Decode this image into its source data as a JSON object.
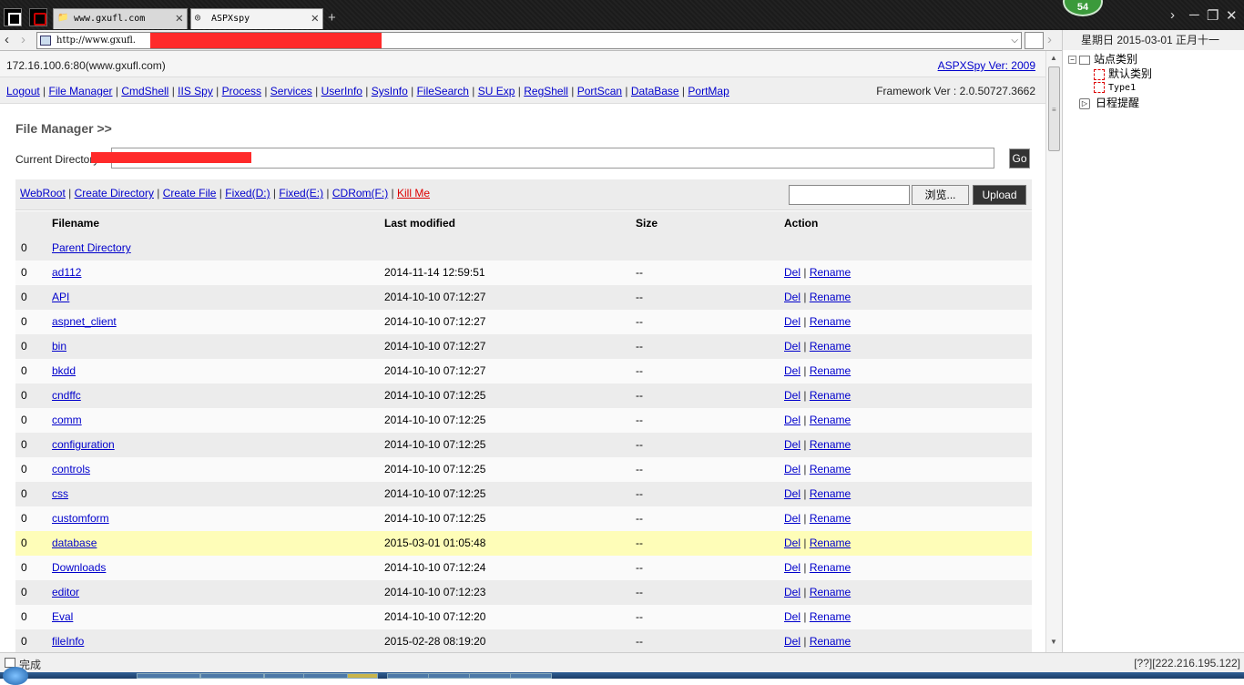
{
  "browser": {
    "tabs": [
      {
        "title": "www.gxufl.com",
        "active": false
      },
      {
        "title": "ASPXspy",
        "active": true
      }
    ],
    "url": "http://www.gxufl.",
    "notification_count": "54"
  },
  "sidepanel": {
    "date": "星期日 2015-03-01 正月十一",
    "tree": {
      "root": "站点类别",
      "children": [
        "默认类别",
        "Type1"
      ],
      "reminder": "日程提醒"
    }
  },
  "page": {
    "host": "172.16.100.6:80(www.gxufl.com)",
    "version_link": "ASPXSpy Ver: 2009",
    "framework": "Framework Ver : 2.0.50727.3662",
    "nav": [
      "Logout",
      "File Manager",
      "CmdShell",
      "IIS Spy",
      "Process",
      "Services",
      "UserInfo",
      "SysInfo",
      "FileSearch",
      "SU Exp",
      "RegShell",
      "PortScan",
      "DataBase",
      "PortMap"
    ],
    "title": "File Manager >>",
    "current_directory_label": "Current Directory",
    "current_directory_value": "",
    "go_label": "Go",
    "tools": [
      "WebRoot",
      "Create Directory",
      "Create File",
      "Fixed(D:)",
      "Fixed(E:)",
      "CDRom(F:)",
      "Kill Me"
    ],
    "browse_label": "浏览...",
    "upload_label": "Upload",
    "columns": [
      "Filename",
      "Last modified",
      "Size",
      "Action"
    ],
    "parent": {
      "num": "0",
      "name": "Parent Directory"
    },
    "rows": [
      {
        "num": "0",
        "name": "ad112",
        "modified": "2014-11-14 12:59:51",
        "size": "--"
      },
      {
        "num": "0",
        "name": "API",
        "modified": "2014-10-10 07:12:27",
        "size": "--"
      },
      {
        "num": "0",
        "name": "aspnet_client",
        "modified": "2014-10-10 07:12:27",
        "size": "--"
      },
      {
        "num": "0",
        "name": "bin",
        "modified": "2014-10-10 07:12:27",
        "size": "--"
      },
      {
        "num": "0",
        "name": "bkdd",
        "modified": "2014-10-10 07:12:27",
        "size": "--"
      },
      {
        "num": "0",
        "name": "cndffc",
        "modified": "2014-10-10 07:12:25",
        "size": "--"
      },
      {
        "num": "0",
        "name": "comm",
        "modified": "2014-10-10 07:12:25",
        "size": "--"
      },
      {
        "num": "0",
        "name": "configuration",
        "modified": "2014-10-10 07:12:25",
        "size": "--"
      },
      {
        "num": "0",
        "name": "controls",
        "modified": "2014-10-10 07:12:25",
        "size": "--"
      },
      {
        "num": "0",
        "name": "css",
        "modified": "2014-10-10 07:12:25",
        "size": "--"
      },
      {
        "num": "0",
        "name": "customform",
        "modified": "2014-10-10 07:12:25",
        "size": "--"
      },
      {
        "num": "0",
        "name": "database",
        "modified": "2015-03-01 01:05:48",
        "size": "--",
        "highlight": true
      },
      {
        "num": "0",
        "name": "Downloads",
        "modified": "2014-10-10 07:12:24",
        "size": "--"
      },
      {
        "num": "0",
        "name": "editor",
        "modified": "2014-10-10 07:12:23",
        "size": "--"
      },
      {
        "num": "0",
        "name": "Eval",
        "modified": "2014-10-10 07:12:20",
        "size": "--"
      },
      {
        "num": "0",
        "name": "fileInfo",
        "modified": "2015-02-28 08:19:20",
        "size": "--"
      }
    ],
    "action_del": "Del",
    "action_rename": "Rename"
  },
  "status": {
    "text": "完成",
    "ip": "[??][222.216.195.122]"
  },
  "colors": {
    "link": "#0000cc",
    "kill_link": "#dd0000",
    "highlight_row": "#fefdb8",
    "redaction": "#ff2a2a"
  }
}
